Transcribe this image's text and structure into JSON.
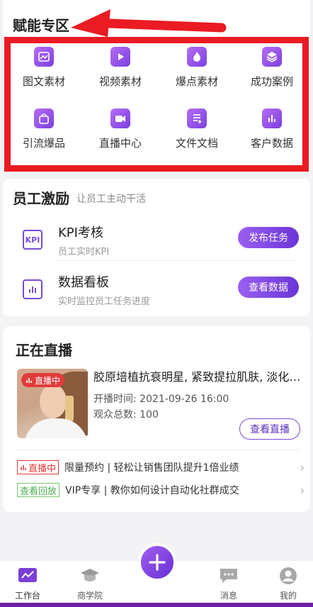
{
  "enable": {
    "title": "赋能专区",
    "items": [
      {
        "label": "图文素材",
        "icon": "image-text-icon"
      },
      {
        "label": "视频素材",
        "icon": "video-icon"
      },
      {
        "label": "爆点素材",
        "icon": "fire-icon"
      },
      {
        "label": "成功案例",
        "icon": "layers-icon"
      },
      {
        "label": "引流爆品",
        "icon": "shopping-bag-icon"
      },
      {
        "label": "直播中心",
        "icon": "live-camera-icon"
      },
      {
        "label": "文件文档",
        "icon": "document-icon"
      },
      {
        "label": "客户数据",
        "icon": "chart-data-icon"
      }
    ]
  },
  "staff": {
    "title": "员工激励",
    "subtitle": "让员工主动干活",
    "rows": [
      {
        "icon_text": "KPI",
        "title": "KPI考核",
        "desc": "员工实时KPI",
        "button": "发布任务"
      },
      {
        "title": "数据看板",
        "desc": "实时监控员工任务进度",
        "button": "查看数据"
      }
    ]
  },
  "live": {
    "title": "正在直播",
    "badge": "直播中",
    "item_title": "胶原培植抗衰明星, 紧致提拉肌肤, 淡化细纹",
    "start_time": "开播时间: 2021-09-26  16:00",
    "viewers": "观众总数: 100",
    "watch_button": "查看直播",
    "notices": [
      {
        "tag": "直播中",
        "text": "限量预约 | 轻松让销售团队提升1倍业绩"
      },
      {
        "tag": "查看回放",
        "text": "VIP专享 | 教你如何设计自动化社群成交"
      }
    ]
  },
  "nav": {
    "items": [
      {
        "label": "工作台",
        "icon": "workbench-icon"
      },
      {
        "label": "商学院",
        "icon": "graduation-cap-icon"
      },
      {
        "label": "消息",
        "icon": "message-icon"
      },
      {
        "label": "我的",
        "icon": "user-icon"
      }
    ],
    "plus_icon": "plus-icon"
  },
  "colors": {
    "accent": "#7a4bd6",
    "highlight": "#ea1b23",
    "live_red": "#e23b3b",
    "replay_green": "#4caf50"
  }
}
